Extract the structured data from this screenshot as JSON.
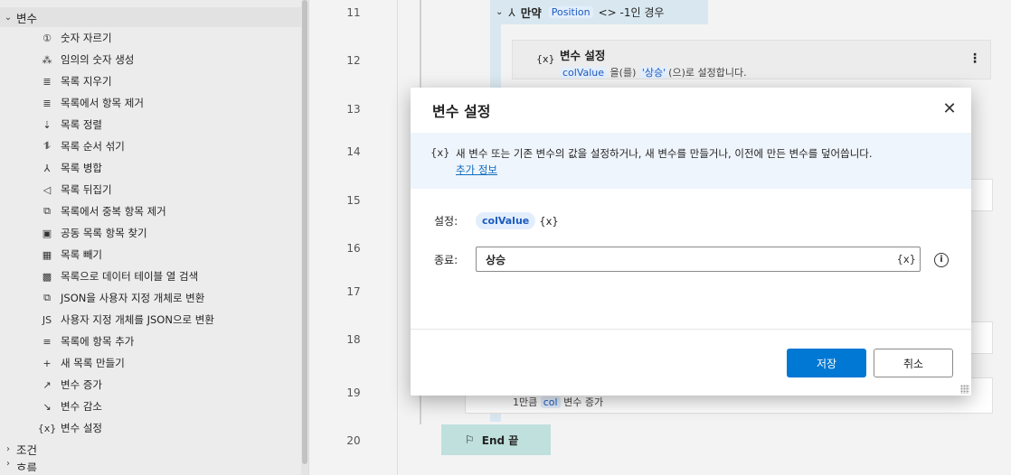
{
  "sidebar": {
    "category_open": "변수",
    "items": [
      {
        "icon": "number-circle-icon",
        "glyph": "①",
        "label": "숫자 자르기"
      },
      {
        "icon": "random-number-icon",
        "glyph": "⁂",
        "label": "임의의 숫자 생성"
      },
      {
        "icon": "clear-list-icon",
        "glyph": "≣",
        "label": "목록 지우기"
      },
      {
        "icon": "remove-item-icon",
        "glyph": "≣",
        "label": "목록에서 항목 제거"
      },
      {
        "icon": "sort-list-icon",
        "glyph": "⇣",
        "label": "목록 정렬"
      },
      {
        "icon": "shuffle-list-icon",
        "glyph": "⥮",
        "label": "목록 순서 섞기"
      },
      {
        "icon": "merge-list-icon",
        "glyph": "⅄",
        "label": "목록 병합"
      },
      {
        "icon": "reverse-list-icon",
        "glyph": "◁",
        "label": "목록 뒤집기"
      },
      {
        "icon": "dedupe-list-icon",
        "glyph": "⧉",
        "label": "목록에서 중복 항목 제거"
      },
      {
        "icon": "common-items-icon",
        "glyph": "▣",
        "label": "공동 목록 항목 찾기"
      },
      {
        "icon": "subtract-list-icon",
        "glyph": "▦",
        "label": "목록 빼기"
      },
      {
        "icon": "datatable-icon",
        "glyph": "▩",
        "label": "목록으로 데이터 테이블 열 검색"
      },
      {
        "icon": "json-convert-icon",
        "glyph": "⧉",
        "label": "JSON을 사용자 지정 개체로 변환"
      },
      {
        "icon": "json-file-icon",
        "glyph": "JS",
        "label": "사용자 지정 개체를 JSON으로 변환"
      },
      {
        "icon": "add-item-icon",
        "glyph": "≡",
        "label": "목록에 항목 추가"
      },
      {
        "icon": "plus-icon",
        "glyph": "+",
        "label": "새 목록 만들기"
      },
      {
        "icon": "trend-up-icon",
        "glyph": "↗",
        "label": "변수 증가"
      },
      {
        "icon": "trend-down-icon",
        "glyph": "↘",
        "label": "변수 감소"
      },
      {
        "icon": "variable-icon",
        "glyph": "{x}",
        "label": "변수 설정"
      }
    ],
    "category_closed": "조건",
    "category_partial": "흐름"
  },
  "canvas": {
    "line_numbers": [
      "11",
      "12",
      "13",
      "14",
      "15",
      "16",
      "17",
      "18",
      "19",
      "20"
    ],
    "if_block": {
      "keyword": "만약",
      "var": "Position",
      "suffix": "<> -1인 경우"
    },
    "set_var_card": {
      "title": "변수 설정",
      "var": "colValue",
      "mid": "을(를)",
      "value": "'상승'",
      "tail": "(으)로 설정합니다."
    },
    "increase_card": {
      "amount": "1만큼",
      "var": "col",
      "tail": "변수 증가"
    },
    "end_label": "End 끝"
  },
  "dialog": {
    "title": "변수 설정",
    "info_text": "새 변수 또는 기존 변수의 값을 설정하거나, 새 변수를 만들거나, 이전에 만든 변수를 덮어씁니다.",
    "info_link": "추가 정보",
    "set_label": "설정:",
    "set_var": "colValue",
    "set_var_icon": "{x}",
    "to_label": "종료:",
    "to_value": "상승",
    "to_var_icon": "{x}",
    "save_label": "저장",
    "cancel_label": "취소"
  },
  "colors": {
    "primary": "#0078d4",
    "link": "#0f6cbd",
    "chip": "#e3eefc",
    "if_block": "#d9e8f0",
    "end_block": "#bfe0dd"
  }
}
